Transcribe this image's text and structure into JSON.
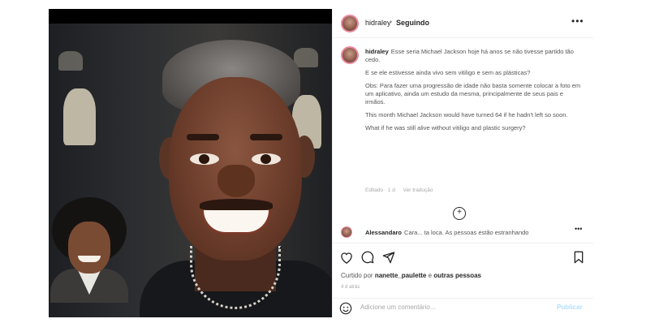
{
  "post": {
    "author": {
      "username": "hidraley",
      "separator": "•",
      "follow_label": "Seguindo"
    },
    "more_icon": "more-horizontal-icon",
    "caption": {
      "username": "hidraley",
      "paragraphs": [
        "Esse seria Michael Jackson hoje há anos se não tivesse partido tão cedo.",
        "E se ele estivesse ainda vivo sem vitiligo e sem as plásticas?",
        "Obs: Para fazer uma progressão de idade não basta somente colocar a foto em um aplicativo, ainda um estudo da mesma, principalmente de seus pais e irmãos.",
        "This month Michael Jackson would have turned 64 if he hadn't left so soon.",
        "What if he was still alive without vitiligo and plastic surgery?"
      ],
      "meta_time": "Editado · 1 d",
      "meta_translate": "Ver tradução"
    },
    "load_more_icon": "plus-circle-icon",
    "first_comment": {
      "username": "Alessandaro",
      "text": "Cara... ta loca. As pessoas estão estranhando",
      "more": "•••"
    },
    "actions": {
      "like_icon": "heart-icon",
      "comment_icon": "comment-icon",
      "share_icon": "send-icon",
      "save_icon": "bookmark-icon"
    },
    "likes": {
      "prefix": "Curtido por",
      "user": "nanette_paulette",
      "connector": "e",
      "others": "outras pessoas"
    },
    "date": "4 d atrás",
    "comment_box": {
      "emoji_icon": "smile-icon",
      "placeholder": "Adicione um comentário...",
      "publish_label": "Publicar"
    }
  },
  "colors": {
    "link_blue": "#b2dffc",
    "avatar_ring": "#ea8aa0",
    "text_primary": "#262626",
    "text_muted": "#a8a8a8"
  }
}
